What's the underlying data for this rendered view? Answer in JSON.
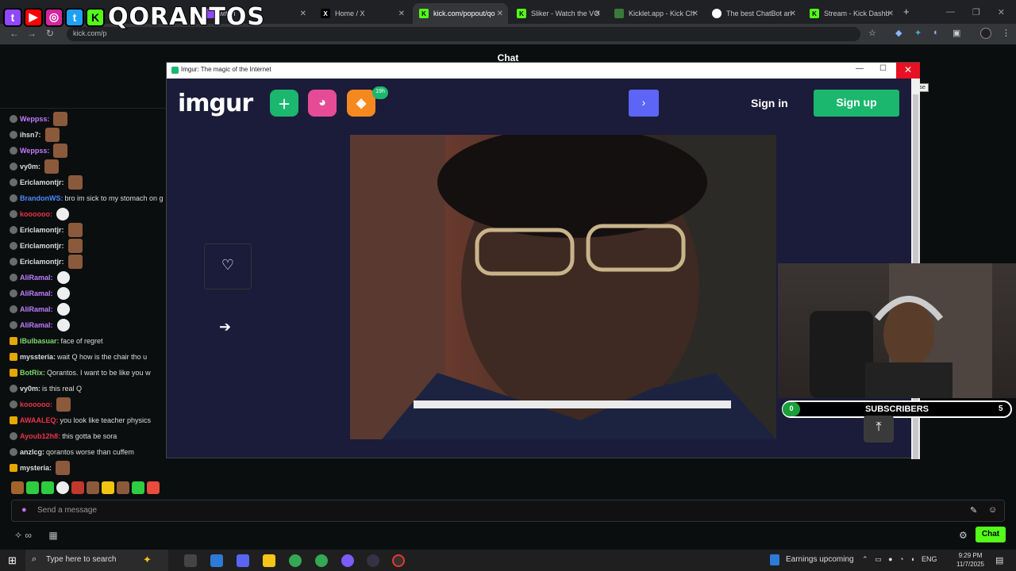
{
  "browser": {
    "tabs": [
      {
        "label": "witch",
        "active": false
      },
      {
        "label": "Home / X",
        "active": false
      },
      {
        "label": "kick.com/popout/qo",
        "active": true
      },
      {
        "label": "Sliker - Watch the VO",
        "active": false
      },
      {
        "label": "Kicklet.app - Kick Ch",
        "active": false
      },
      {
        "label": "The best ChatBot an",
        "active": false
      },
      {
        "label": "Stream - Kick Dashb",
        "active": false
      }
    ],
    "url": "kick.com/p"
  },
  "overlay": {
    "streamer_name": "QORANTOS"
  },
  "chat": {
    "header": "Chat",
    "messages": [
      {
        "user": "Weppss:",
        "color": "#c07cff",
        "text": "",
        "emote": "face"
      },
      {
        "user": "ihsn7:",
        "color": "#dddddd",
        "text": "",
        "emote": "face"
      },
      {
        "user": "Weppss:",
        "color": "#c07cff",
        "text": "",
        "emote": "face"
      },
      {
        "user": "vy0m:",
        "color": "#dddddd",
        "text": "",
        "emote": "face"
      },
      {
        "user": "Ericlamontjr:",
        "color": "#dddddd",
        "text": "",
        "emote": "face"
      },
      {
        "user": "BrandonWS:",
        "color": "#4a8bff",
        "text": "bro im sick to my stomach on g",
        "emote": ""
      },
      {
        "user": "koooooo:",
        "color": "#e8354a",
        "text": "",
        "emote": "ghost"
      },
      {
        "user": "Ericlamontjr:",
        "color": "#dddddd",
        "text": "",
        "emote": "face"
      },
      {
        "user": "Ericlamontjr:",
        "color": "#dddddd",
        "text": "",
        "emote": "face"
      },
      {
        "user": "Ericlamontjr:",
        "color": "#dddddd",
        "text": "",
        "emote": "face"
      },
      {
        "user": "AliRamal:",
        "color": "#c07cff",
        "text": "",
        "emote": "ghost"
      },
      {
        "user": "AliRamal:",
        "color": "#c07cff",
        "text": "",
        "emote": "ghost"
      },
      {
        "user": "AliRamal:",
        "color": "#c07cff",
        "text": "",
        "emote": "ghost"
      },
      {
        "user": "AliRamal:",
        "color": "#c07cff",
        "text": "",
        "emote": "ghost"
      },
      {
        "user": "IBulbasuar:",
        "color": "#7dd96b",
        "text": "face of regret",
        "emote": ""
      },
      {
        "user": "myssteria:",
        "color": "#dddddd",
        "text": "wait Q how is the chair tho u",
        "emote": ""
      },
      {
        "user": "BotRix:",
        "color": "#7dd96b",
        "text": "Qorantos. I want to be like you w",
        "emote": ""
      },
      {
        "user": "vy0m:",
        "color": "#dddddd",
        "text": "is this real Q",
        "emote": ""
      },
      {
        "user": "koooooo:",
        "color": "#e8354a",
        "text": "",
        "emote": "face"
      },
      {
        "user": "AWAALEQ:",
        "color": "#e8354a",
        "text": "you look like teacher physics",
        "emote": ""
      },
      {
        "user": "Ayoub12h8:",
        "color": "#e8354a",
        "text": "this gotta be sora",
        "emote": ""
      },
      {
        "user": "anzlcg:",
        "color": "#dddddd",
        "text": "qorantos worse than cuffem",
        "emote": ""
      },
      {
        "user": "mysteria:",
        "color": "#dddddd",
        "text": "",
        "emote": "face"
      }
    ],
    "input_placeholder": "Send a message",
    "chat_button": "Chat"
  },
  "popup": {
    "title": "Imgur: The magic of the Internet",
    "close_tooltip": "Close",
    "logo": "imgur",
    "badge": "19h",
    "sign_in": "Sign in",
    "sign_up": "Sign up"
  },
  "subs": {
    "label": "SUBSCRIBERS",
    "current": "0",
    "goal": "5"
  },
  "taskbar": {
    "search_placeholder": "Type here to search",
    "news": "Earnings upcoming",
    "lang": "ENG",
    "time": "9:29 PM",
    "date": "11/7/2025"
  },
  "colors": {
    "kick_green": "#53fc18",
    "imgur_green": "#1bb76e",
    "imgur_bg": "#1b1b3a",
    "imgur_blue": "#5c65f5"
  }
}
